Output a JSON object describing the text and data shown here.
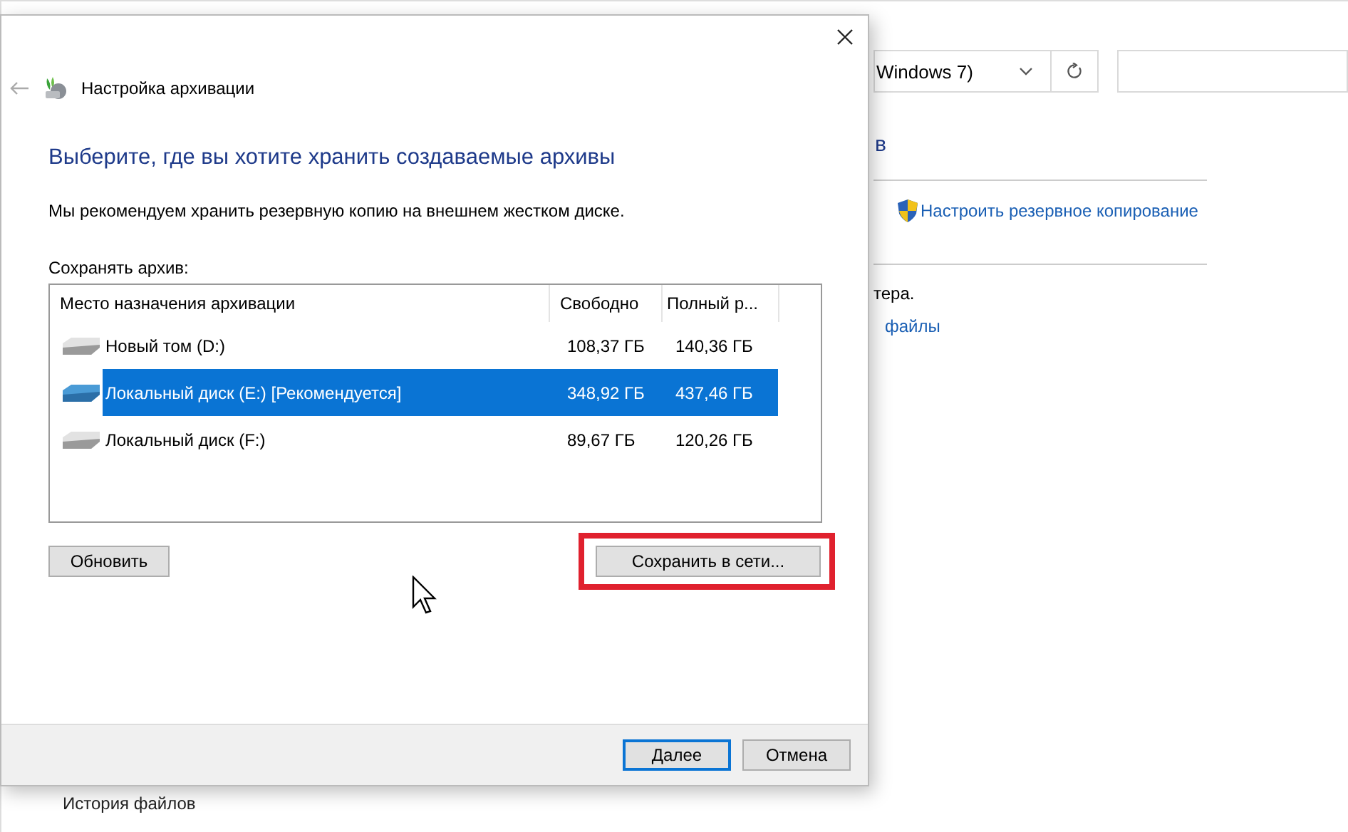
{
  "background_window": {
    "location": "Windows 7)",
    "heading_fragment": "в",
    "link": "Настроить резервное копирование",
    "text_fragment": "тера.",
    "link_fragment": "файлы",
    "sidebar_item": "История файлов"
  },
  "dialog": {
    "title": "Настройка архивации",
    "heading": "Выберите, где вы хотите хранить создаваемые архивы",
    "description": "Мы рекомендуем хранить резервную копию на внешнем жестком диске.",
    "list_label": "Сохранять архив:",
    "columns": [
      "Место назначения архивации",
      "Свободно",
      "Полный р..."
    ],
    "rows": [
      {
        "name": "Новый том (D:)",
        "free": "108,37 ГБ",
        "total": "140,36 ГБ",
        "selected": false
      },
      {
        "name": "Локальный диск (E:) [Рекомендуется]",
        "free": "348,92 ГБ",
        "total": "437,46 ГБ",
        "selected": true
      },
      {
        "name": "Локальный диск (F:)",
        "free": "89,67 ГБ",
        "total": "120,26 ГБ",
        "selected": false
      }
    ],
    "buttons": [
      {
        "label": "Обновить",
        "highlighted": false
      },
      {
        "label": "Сохранить в сети...",
        "highlighted": true
      }
    ],
    "footer_buttons": [
      {
        "label": "Далее",
        "default": true
      },
      {
        "label": "Отмена",
        "default": false
      }
    ]
  }
}
